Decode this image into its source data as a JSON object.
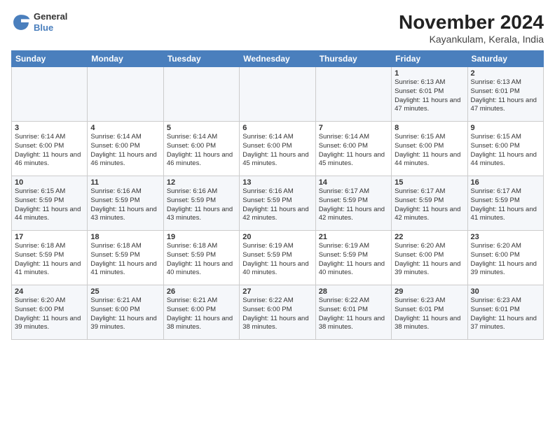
{
  "header": {
    "title": "November 2024",
    "subtitle": "Kayankulam, Kerala, India",
    "logo_general": "General",
    "logo_blue": "Blue"
  },
  "days_of_week": [
    "Sunday",
    "Monday",
    "Tuesday",
    "Wednesday",
    "Thursday",
    "Friday",
    "Saturday"
  ],
  "weeks": [
    [
      {
        "day": "",
        "info": ""
      },
      {
        "day": "",
        "info": ""
      },
      {
        "day": "",
        "info": ""
      },
      {
        "day": "",
        "info": ""
      },
      {
        "day": "",
        "info": ""
      },
      {
        "day": "1",
        "info": "Sunrise: 6:13 AM\nSunset: 6:01 PM\nDaylight: 11 hours and 47 minutes."
      },
      {
        "day": "2",
        "info": "Sunrise: 6:13 AM\nSunset: 6:01 PM\nDaylight: 11 hours and 47 minutes."
      }
    ],
    [
      {
        "day": "3",
        "info": "Sunrise: 6:14 AM\nSunset: 6:00 PM\nDaylight: 11 hours and 46 minutes."
      },
      {
        "day": "4",
        "info": "Sunrise: 6:14 AM\nSunset: 6:00 PM\nDaylight: 11 hours and 46 minutes."
      },
      {
        "day": "5",
        "info": "Sunrise: 6:14 AM\nSunset: 6:00 PM\nDaylight: 11 hours and 46 minutes."
      },
      {
        "day": "6",
        "info": "Sunrise: 6:14 AM\nSunset: 6:00 PM\nDaylight: 11 hours and 45 minutes."
      },
      {
        "day": "7",
        "info": "Sunrise: 6:14 AM\nSunset: 6:00 PM\nDaylight: 11 hours and 45 minutes."
      },
      {
        "day": "8",
        "info": "Sunrise: 6:15 AM\nSunset: 6:00 PM\nDaylight: 11 hours and 44 minutes."
      },
      {
        "day": "9",
        "info": "Sunrise: 6:15 AM\nSunset: 6:00 PM\nDaylight: 11 hours and 44 minutes."
      }
    ],
    [
      {
        "day": "10",
        "info": "Sunrise: 6:15 AM\nSunset: 5:59 PM\nDaylight: 11 hours and 44 minutes."
      },
      {
        "day": "11",
        "info": "Sunrise: 6:16 AM\nSunset: 5:59 PM\nDaylight: 11 hours and 43 minutes."
      },
      {
        "day": "12",
        "info": "Sunrise: 6:16 AM\nSunset: 5:59 PM\nDaylight: 11 hours and 43 minutes."
      },
      {
        "day": "13",
        "info": "Sunrise: 6:16 AM\nSunset: 5:59 PM\nDaylight: 11 hours and 42 minutes."
      },
      {
        "day": "14",
        "info": "Sunrise: 6:17 AM\nSunset: 5:59 PM\nDaylight: 11 hours and 42 minutes."
      },
      {
        "day": "15",
        "info": "Sunrise: 6:17 AM\nSunset: 5:59 PM\nDaylight: 11 hours and 42 minutes."
      },
      {
        "day": "16",
        "info": "Sunrise: 6:17 AM\nSunset: 5:59 PM\nDaylight: 11 hours and 41 minutes."
      }
    ],
    [
      {
        "day": "17",
        "info": "Sunrise: 6:18 AM\nSunset: 5:59 PM\nDaylight: 11 hours and 41 minutes."
      },
      {
        "day": "18",
        "info": "Sunrise: 6:18 AM\nSunset: 5:59 PM\nDaylight: 11 hours and 41 minutes."
      },
      {
        "day": "19",
        "info": "Sunrise: 6:18 AM\nSunset: 5:59 PM\nDaylight: 11 hours and 40 minutes."
      },
      {
        "day": "20",
        "info": "Sunrise: 6:19 AM\nSunset: 5:59 PM\nDaylight: 11 hours and 40 minutes."
      },
      {
        "day": "21",
        "info": "Sunrise: 6:19 AM\nSunset: 5:59 PM\nDaylight: 11 hours and 40 minutes."
      },
      {
        "day": "22",
        "info": "Sunrise: 6:20 AM\nSunset: 6:00 PM\nDaylight: 11 hours and 39 minutes."
      },
      {
        "day": "23",
        "info": "Sunrise: 6:20 AM\nSunset: 6:00 PM\nDaylight: 11 hours and 39 minutes."
      }
    ],
    [
      {
        "day": "24",
        "info": "Sunrise: 6:20 AM\nSunset: 6:00 PM\nDaylight: 11 hours and 39 minutes."
      },
      {
        "day": "25",
        "info": "Sunrise: 6:21 AM\nSunset: 6:00 PM\nDaylight: 11 hours and 39 minutes."
      },
      {
        "day": "26",
        "info": "Sunrise: 6:21 AM\nSunset: 6:00 PM\nDaylight: 11 hours and 38 minutes."
      },
      {
        "day": "27",
        "info": "Sunrise: 6:22 AM\nSunset: 6:00 PM\nDaylight: 11 hours and 38 minutes."
      },
      {
        "day": "28",
        "info": "Sunrise: 6:22 AM\nSunset: 6:01 PM\nDaylight: 11 hours and 38 minutes."
      },
      {
        "day": "29",
        "info": "Sunrise: 6:23 AM\nSunset: 6:01 PM\nDaylight: 11 hours and 38 minutes."
      },
      {
        "day": "30",
        "info": "Sunrise: 6:23 AM\nSunset: 6:01 PM\nDaylight: 11 hours and 37 minutes."
      }
    ]
  ]
}
